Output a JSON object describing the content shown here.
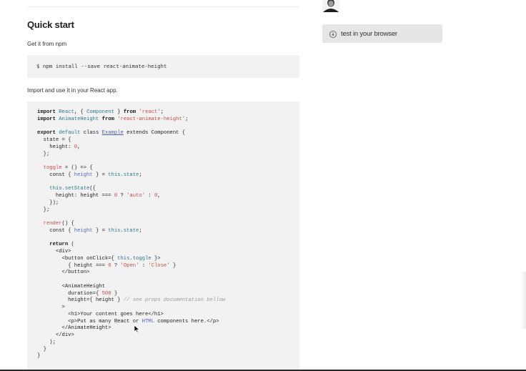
{
  "section": {
    "title": "Quick start",
    "get_text": "Get it from npm",
    "install_command": "$ npm install --save react-animate-height",
    "import_text": "Import and use it in your React app."
  },
  "sidebar": {
    "test_button_label": "test in your browser"
  },
  "code_lines": [
    [
      [
        "kw",
        "import"
      ],
      [
        "plain",
        " "
      ],
      [
        "class",
        "React"
      ],
      [
        "plain",
        ", { "
      ],
      [
        "class",
        "Component"
      ],
      [
        "plain",
        " } "
      ],
      [
        "kw",
        "from"
      ],
      [
        "plain",
        " "
      ],
      [
        "str",
        "'react'"
      ],
      [
        "plain",
        ";"
      ]
    ],
    [
      [
        "kw",
        "import"
      ],
      [
        "plain",
        " "
      ],
      [
        "class",
        "AnimateHeight"
      ],
      [
        "plain",
        " "
      ],
      [
        "kw",
        "from"
      ],
      [
        "plain",
        " "
      ],
      [
        "str",
        "'react-animate-height'"
      ],
      [
        "plain",
        ";"
      ]
    ],
    [
      [
        "plain",
        ""
      ]
    ],
    [
      [
        "kw",
        "export"
      ],
      [
        "plain",
        " "
      ],
      [
        "class",
        "default"
      ],
      [
        "plain",
        " class "
      ],
      [
        "link",
        "Example"
      ],
      [
        "plain",
        " extends Component {"
      ]
    ],
    [
      [
        "plain",
        "  state = {"
      ]
    ],
    [
      [
        "plain",
        "    height: "
      ],
      [
        "num",
        "0"
      ],
      [
        "plain",
        ","
      ]
    ],
    [
      [
        "plain",
        "  };"
      ]
    ],
    [
      [
        "plain",
        ""
      ]
    ],
    [
      [
        "plain",
        "  "
      ],
      [
        "fn",
        "toggle"
      ],
      [
        "plain",
        " = () => {"
      ]
    ],
    [
      [
        "plain",
        "    const { "
      ],
      [
        "prop",
        "height"
      ],
      [
        "plain",
        " } = "
      ],
      [
        "this",
        "this.state"
      ],
      [
        "plain",
        ";"
      ]
    ],
    [
      [
        "plain",
        ""
      ]
    ],
    [
      [
        "plain",
        "    "
      ],
      [
        "this",
        "this.setState"
      ],
      [
        "plain",
        "({"
      ]
    ],
    [
      [
        "plain",
        "      height: height === "
      ],
      [
        "num",
        "0"
      ],
      [
        "plain",
        " ? "
      ],
      [
        "str",
        "'auto'"
      ],
      [
        "plain",
        " : "
      ],
      [
        "num",
        "0"
      ],
      [
        "plain",
        ","
      ]
    ],
    [
      [
        "plain",
        "    });"
      ]
    ],
    [
      [
        "plain",
        "  };"
      ]
    ],
    [
      [
        "plain",
        ""
      ]
    ],
    [
      [
        "plain",
        "  "
      ],
      [
        "fn",
        "render"
      ],
      [
        "plain",
        "() {"
      ]
    ],
    [
      [
        "plain",
        "    const { "
      ],
      [
        "prop",
        "height"
      ],
      [
        "plain",
        " } = "
      ],
      [
        "this",
        "this.state"
      ],
      [
        "plain",
        ";"
      ]
    ],
    [
      [
        "plain",
        ""
      ]
    ],
    [
      [
        "plain",
        "    "
      ],
      [
        "kw",
        "return"
      ],
      [
        "plain",
        " ("
      ]
    ],
    [
      [
        "plain",
        "      <div>"
      ]
    ],
    [
      [
        "plain",
        "        <button onClick={ "
      ],
      [
        "this",
        "this.toggle"
      ],
      [
        "plain",
        " }>"
      ]
    ],
    [
      [
        "plain",
        "          { height === "
      ],
      [
        "num",
        "0"
      ],
      [
        "plain",
        " ? "
      ],
      [
        "str",
        "'Open'"
      ],
      [
        "plain",
        " : "
      ],
      [
        "str",
        "'Close'"
      ],
      [
        "plain",
        " }"
      ]
    ],
    [
      [
        "plain",
        "        </button>"
      ]
    ],
    [
      [
        "plain",
        ""
      ]
    ],
    [
      [
        "plain",
        "        <AnimateHeight"
      ]
    ],
    [
      [
        "plain",
        "          duration={ "
      ],
      [
        "num",
        "500"
      ],
      [
        "plain",
        " }"
      ]
    ],
    [
      [
        "plain",
        "          height={ height } "
      ],
      [
        "comment",
        "// see props documentation bellow"
      ]
    ],
    [
      [
        "plain",
        "        >"
      ]
    ],
    [
      [
        "plain",
        "          <h1>Your content goes here</h1>"
      ]
    ],
    [
      [
        "plain",
        "          <p>Put as many React or "
      ],
      [
        "html",
        "HTML"
      ],
      [
        "plain",
        " components here.</p>"
      ]
    ],
    [
      [
        "plain",
        "        </AnimateHeight>"
      ]
    ],
    [
      [
        "plain",
        "      </div>"
      ]
    ],
    [
      [
        "plain",
        "    );"
      ]
    ],
    [
      [
        "plain",
        "  }"
      ]
    ],
    [
      [
        "plain",
        "}"
      ]
    ]
  ]
}
